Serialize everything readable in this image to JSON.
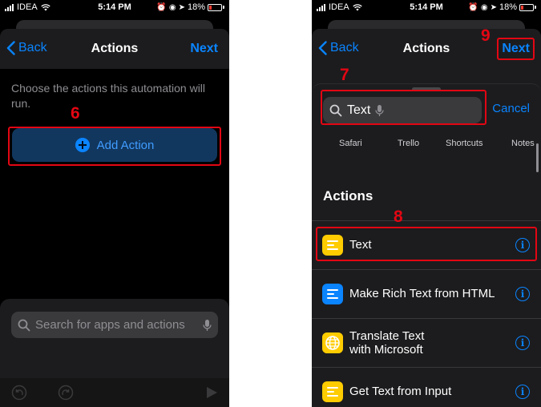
{
  "status_bar": {
    "carrier": "IDEA",
    "time": "5:14 PM",
    "battery": "18%",
    "battery_level": 0.18
  },
  "left_screen": {
    "nav": {
      "back": "Back",
      "title": "Actions",
      "next": "Next"
    },
    "description": "Choose the actions this automation will run.",
    "add_action": "Add Action",
    "search_placeholder": "Search for apps and actions",
    "step": "6"
  },
  "right_screen": {
    "nav": {
      "back": "Back",
      "title": "Actions",
      "next": "Next"
    },
    "search_value": "Text",
    "cancel": "Cancel",
    "categories": [
      "Safari",
      "Trello",
      "Shortcuts",
      "Notes"
    ],
    "section_title": "Actions",
    "actions": [
      {
        "label": "Text",
        "icon": "text-document-icon",
        "color": "#ffcc00"
      },
      {
        "label": "Make Rich Text from HTML",
        "icon": "rich-text-icon",
        "color": "#0a84ff"
      },
      {
        "label": "Translate Text\nwith Microsoft",
        "icon": "globe-icon",
        "color": "#ffcc00"
      },
      {
        "label": "Get Text from Input",
        "icon": "text-document-icon",
        "color": "#ffcc00"
      }
    ],
    "steps": {
      "search": "7",
      "text_row": "8",
      "next": "9"
    }
  },
  "colors": {
    "accent": "#0a84ff",
    "annotation": "#e30613",
    "background": "#000000"
  }
}
